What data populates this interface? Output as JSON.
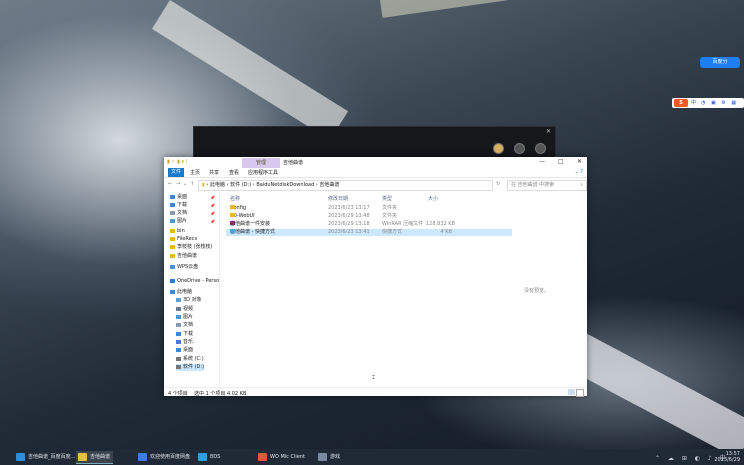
{
  "explorer": {
    "context_tab": "管理",
    "window_title": "吉他曲谱",
    "window_buttons": {
      "minimize": "—",
      "maximize": "□",
      "close": "✕"
    },
    "ribbon_tabs": [
      "文件",
      "主页",
      "共享",
      "查看",
      "应用程序工具"
    ],
    "address_path": "› 此电脑 › 软件 (D:) › BaiduNetdiskDownload › 吉他曲谱",
    "search_placeholder": "在 吉他曲谱 中搜索",
    "nav_items": [
      {
        "label": "桌面",
        "icon": "desktop-icon"
      },
      {
        "label": "下载",
        "icon": "download-icon"
      },
      {
        "label": "文档",
        "icon": "documents-icon"
      },
      {
        "label": "图片",
        "icon": "pictures-icon"
      },
      {
        "label": "bin",
        "icon": "folder-icon"
      },
      {
        "label": "FileRecv",
        "icon": "folder-icon"
      },
      {
        "label": "李枝枝 (张枝枝)",
        "icon": "folder-icon"
      },
      {
        "label": "吉他曲谱",
        "icon": "folder-icon"
      },
      {
        "label": "WPS云盘",
        "icon": "cloud-icon"
      },
      {
        "label": "OneDrive - Perso",
        "icon": "onedrive-icon"
      },
      {
        "label": "此电脑",
        "icon": "computer-icon"
      },
      {
        "label": "3D 对象",
        "icon": "3d-objects-icon"
      },
      {
        "label": "视频",
        "icon": "video-icon"
      },
      {
        "label": "图片",
        "icon": "pictures-icon"
      },
      {
        "label": "文档",
        "icon": "documents-icon"
      },
      {
        "label": "下载",
        "icon": "download-icon"
      },
      {
        "label": "音乐",
        "icon": "music-icon"
      },
      {
        "label": "桌面",
        "icon": "desktop-icon"
      },
      {
        "label": "系统 (C:)",
        "icon": "drive-icon"
      },
      {
        "label": "软件 (D:)",
        "icon": "drive-icon"
      }
    ],
    "columns": {
      "name": "名称",
      "date": "修改日期",
      "type": "类型",
      "size": "大小"
    },
    "files": [
      {
        "name": "Config",
        "date": "2023/6/23 13:17",
        "type": "文件夹",
        "size": "",
        "icon": "folder-icon"
      },
      {
        "name": "SD-WebUI",
        "date": "2023/6/29 13:48",
        "type": "文件夹",
        "size": "",
        "icon": "folder-icon"
      },
      {
        "name": "吉他曲谱一件安装",
        "date": "2023/6/29 13:18",
        "type": "WinRAR 压缩文件",
        "size": "128,832 KB",
        "icon": "rar-icon"
      },
      {
        "name": "吉他曲谱 - 快捷方式",
        "date": "2023/6/23 13:41",
        "type": "快捷方式",
        "size": "4 KB",
        "icon": "shortcut-icon"
      }
    ],
    "preview_hint": "没有预览。",
    "status_count": "4 个项目",
    "status_selected": "选中 1 个项目  4.02 KB"
  },
  "taskbar": {
    "items": [
      {
        "label": "吉他曲谱_百度百度...",
        "icon": "edge-icon",
        "color": "#2f8fd8"
      },
      {
        "label": "吉他曲谱",
        "icon": "folder-icon",
        "color": "#e8c040"
      },
      {
        "label": "欢迎使用百度网盘",
        "icon": "baidu-netdisk-icon",
        "color": "#3b7cf0"
      },
      {
        "label": "BDS",
        "icon": "app-icon",
        "color": "#2e9fe0"
      },
      {
        "label": "WO Mic Client",
        "icon": "microphone-icon",
        "color": "#e05a30"
      },
      {
        "label": "游戏",
        "icon": "game-icon",
        "color": "#7a8aa0"
      }
    ],
    "time": "13:57",
    "date": "2023/6/29"
  },
  "widgets": {
    "netdisk_label": "百度分",
    "ime_logo": "S",
    "ime_lang": "中"
  }
}
